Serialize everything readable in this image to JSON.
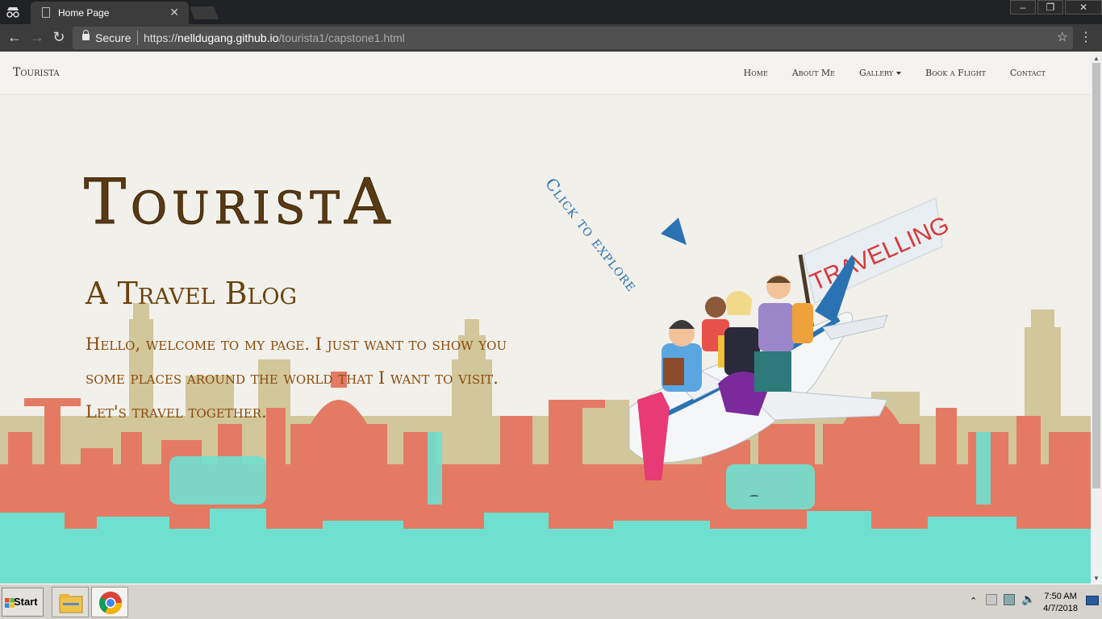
{
  "browser": {
    "tab_title": "Home Page",
    "secure_label": "Secure",
    "url_scheme": "https://",
    "url_host": "nelldugang.github.io",
    "url_path": "/tourista1/capstone1.html"
  },
  "site": {
    "brand": "Tourista",
    "nav": [
      "Home",
      "About Me",
      "Gallery",
      "Book a Flight",
      "Contact"
    ]
  },
  "hero": {
    "title": "TouristA",
    "subtitle": "A Travel Blog",
    "text": "Hello, welcome to my page. I just want to show you some places around the world that I want to visit. Let's travel together.",
    "explore": "Click to explore",
    "flag": "TRAVELLING"
  },
  "taskbar": {
    "start": "Start",
    "time": "7:50 AM",
    "date": "4/7/2018"
  },
  "colors": {
    "teal": "#6fe0cf",
    "coral": "#e47a64",
    "sand": "#cdbf8e",
    "title_brown": "#5a3a12",
    "explore_blue": "#2a72b2"
  }
}
